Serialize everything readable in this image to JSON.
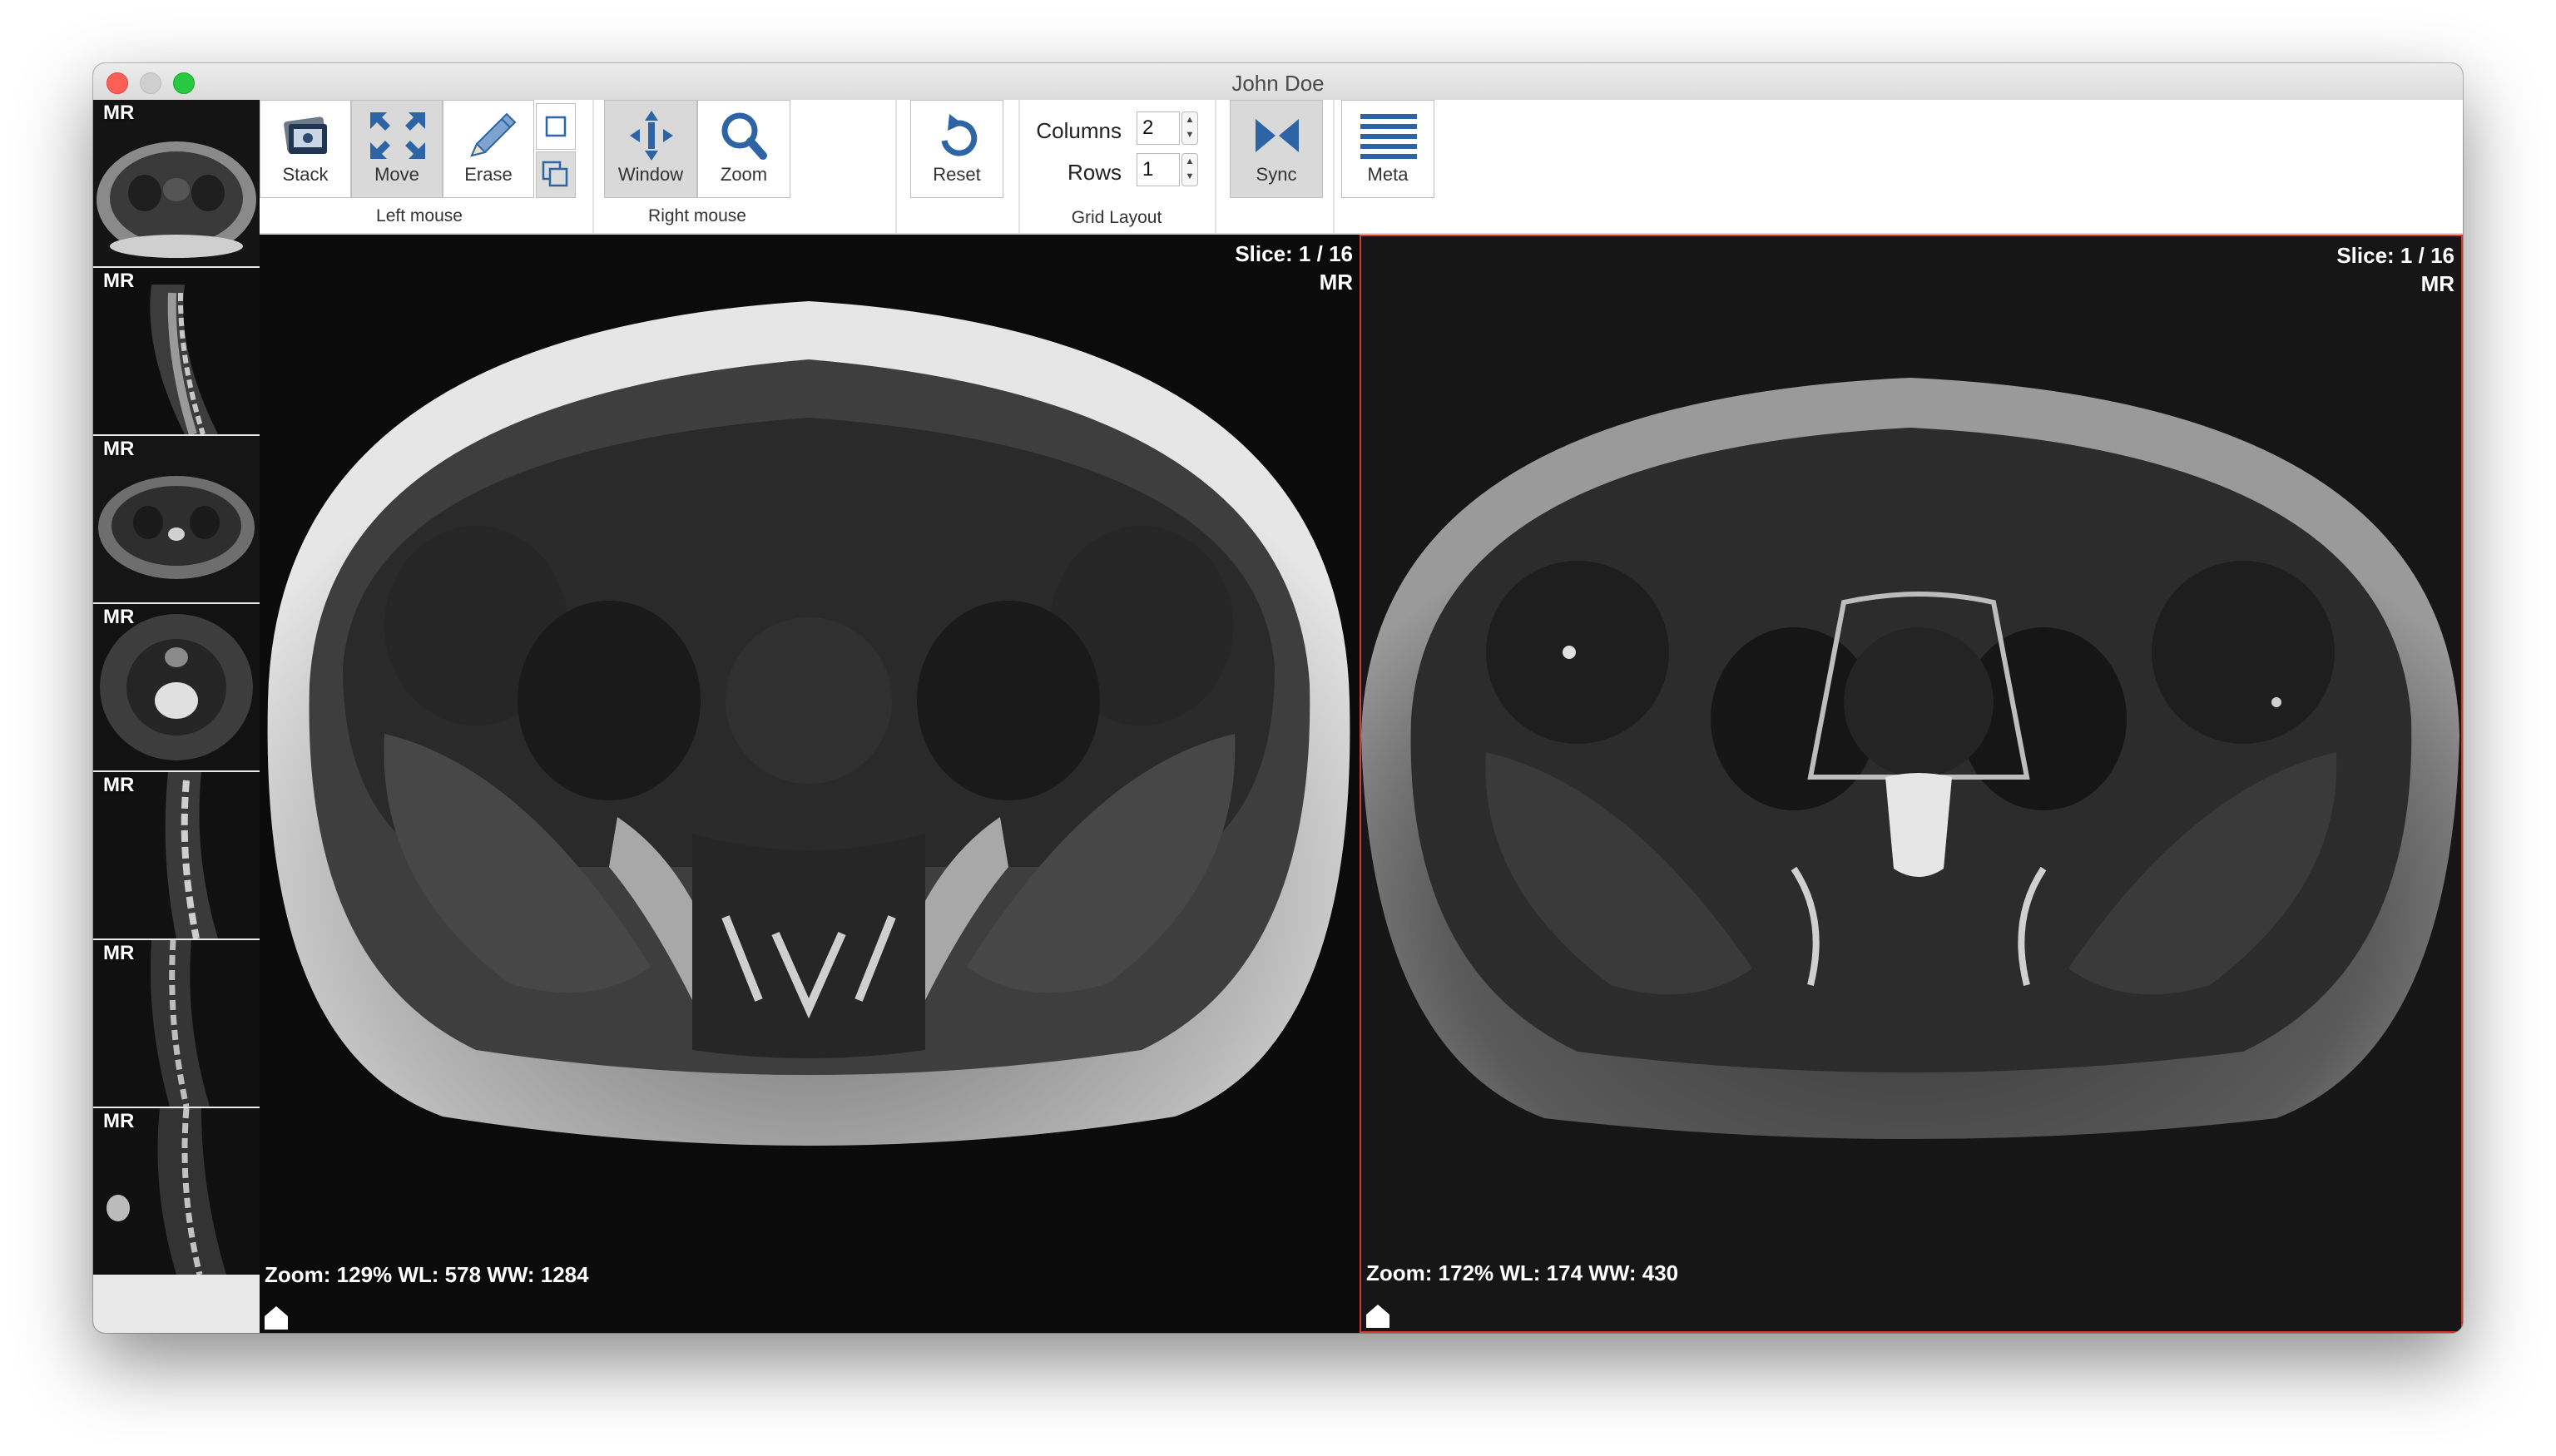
{
  "window": {
    "title": "John Doe"
  },
  "sidebar": {
    "thumbnails": [
      {
        "modality": "MR",
        "view": "axial"
      },
      {
        "modality": "MR",
        "view": "sagittal"
      },
      {
        "modality": "MR",
        "view": "axial"
      },
      {
        "modality": "MR",
        "view": "axial-bright"
      },
      {
        "modality": "MR",
        "view": "sagittal"
      },
      {
        "modality": "MR",
        "view": "sagittal"
      },
      {
        "modality": "MR",
        "view": "sagittal"
      }
    ]
  },
  "toolbar": {
    "left_mouse": {
      "caption": "Left mouse",
      "buttons": [
        {
          "label": "Stack",
          "icon": "stack-icon",
          "active": false
        },
        {
          "label": "Move",
          "icon": "move-arrows-icon",
          "active": true
        },
        {
          "label": "Erase",
          "icon": "pencil-icon",
          "active": false
        }
      ],
      "small_buttons": [
        {
          "icon": "single-frame-icon",
          "active": false
        },
        {
          "icon": "multi-frame-icon",
          "active": true
        }
      ]
    },
    "right_mouse": {
      "caption": "Right mouse",
      "buttons": [
        {
          "label": "Window",
          "icon": "window-level-icon",
          "active": true
        },
        {
          "label": "Zoom",
          "icon": "magnifier-icon",
          "active": false
        }
      ]
    },
    "reset": {
      "label": "Reset",
      "icon": "reset-icon"
    },
    "grid_layout": {
      "caption": "Grid Layout",
      "columns_label": "Columns",
      "columns_value": "2",
      "rows_label": "Rows",
      "rows_value": "1"
    },
    "sync": {
      "label": "Sync",
      "icon": "sync-icon",
      "active": true
    },
    "meta": {
      "label": "Meta",
      "icon": "meta-lines-icon"
    }
  },
  "viewports": [
    {
      "slice": "Slice: 1 / 16",
      "modality": "MR",
      "info": "Zoom: 129% WL: 578 WW: 1284",
      "selected": false
    },
    {
      "slice": "Slice: 1 / 16",
      "modality": "MR",
      "info": "Zoom: 172% WL: 174 WW: 430",
      "selected": true
    }
  ],
  "colors": {
    "accent_border": "#d43a2f",
    "icon_blue": "#2d64a6",
    "toolbar_active": "#d9d9d9"
  }
}
